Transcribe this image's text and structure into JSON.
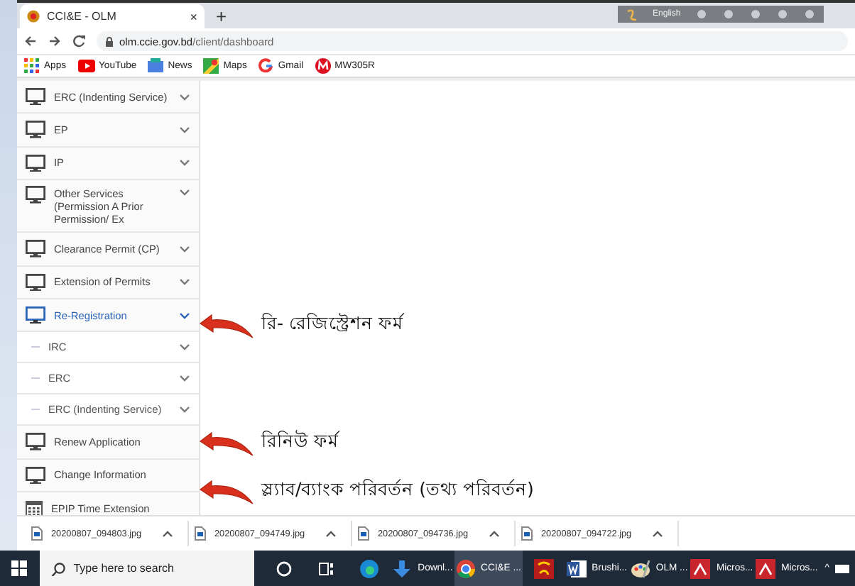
{
  "browser": {
    "tab": {
      "title": "CCI&E - OLM",
      "close": "×"
    },
    "new_tab": "+",
    "address": {
      "domain": "olm.ccie.gov.bd",
      "path": "/client/dashboard"
    },
    "bookmarks": [
      {
        "label": "Apps"
      },
      {
        "label": "YouTube"
      },
      {
        "label": "News"
      },
      {
        "label": "Maps"
      },
      {
        "label": "Gmail"
      },
      {
        "label": "MW305R"
      }
    ]
  },
  "ime_toolbar": {
    "language": "English"
  },
  "sidebar": {
    "items": [
      {
        "label": "ERC (Indenting Service)",
        "expandable": true,
        "selected": false
      },
      {
        "label": "EP",
        "expandable": true,
        "selected": false
      },
      {
        "label": "IP",
        "expandable": true,
        "selected": false
      },
      {
        "label": "Other Services (Permission A Prior Permission/ Ex",
        "expandable": true,
        "selected": false
      },
      {
        "label": "Clearance Permit (CP)",
        "expandable": true,
        "selected": false
      },
      {
        "label": "Extension of Permits",
        "expandable": true,
        "selected": false
      },
      {
        "label": "Re-Registration",
        "expandable": true,
        "selected": true,
        "children": [
          {
            "label": "IRC",
            "expandable": true,
            "selected": false
          },
          {
            "label": "ERC",
            "expandable": true,
            "selected": false
          },
          {
            "label": "ERC (Indenting Service)",
            "expandable": true,
            "selected": false
          }
        ]
      },
      {
        "label": "Renew Application",
        "expandable": false,
        "selected": false
      },
      {
        "label": "Change Information",
        "expandable": false,
        "selected": false
      },
      {
        "label": "EPIP Time Extension",
        "expandable": false,
        "selected": false
      }
    ]
  },
  "annotations": [
    {
      "text": "রি- রেজিস্ট্রেশন ফর্ম"
    },
    {
      "text": "রিনিউ ফর্ম"
    },
    {
      "text": "স্ল্যাব/ব্যাংক পরিবর্তন (তথ্য পরিবর্তন)"
    }
  ],
  "downloads": [
    {
      "file": "20200807_094803.jpg"
    },
    {
      "file": "20200807_094749.jpg"
    },
    {
      "file": "20200807_094736.jpg"
    },
    {
      "file": "20200807_094722.jpg"
    }
  ],
  "taskbar": {
    "search_placeholder": "Type here to search",
    "apps": [
      {
        "active": false
      },
      {
        "active": false
      },
      {
        "active": false
      },
      {
        "label": "Downl...",
        "active": false
      },
      {
        "label": "CCI&E ...",
        "active": true
      },
      {
        "active": false
      },
      {
        "label": "Brushi...",
        "active": false
      },
      {
        "label": "OLM ...",
        "active": false
      },
      {
        "label": "Micros...",
        "active": false
      },
      {
        "label": "Micros...",
        "active": false
      }
    ],
    "tray_caret": "^"
  }
}
